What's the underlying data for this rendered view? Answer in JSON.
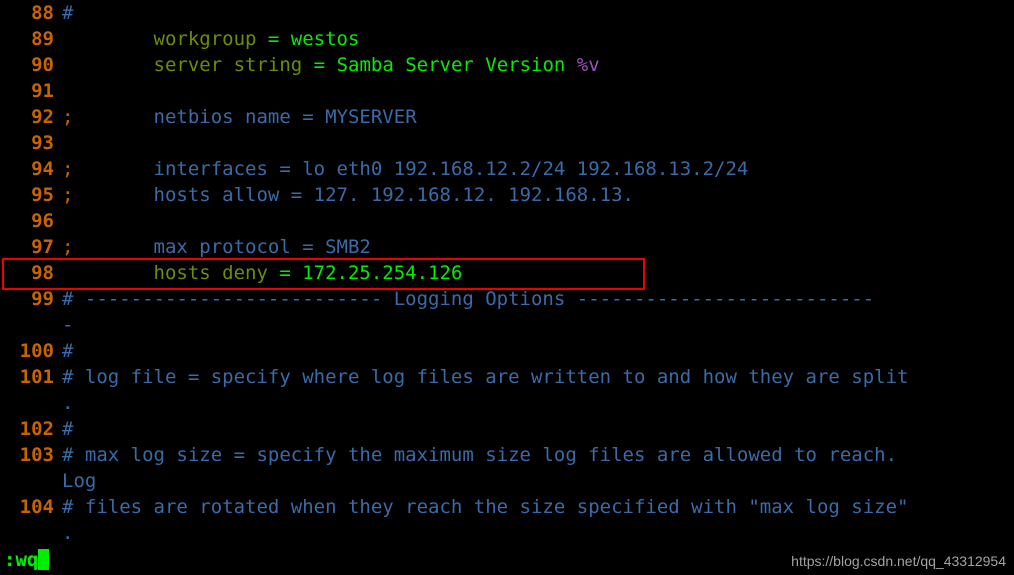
{
  "app": {
    "kind": "terminal-vim-editor",
    "background": "#000000",
    "filename_context": "smb.conf"
  },
  "colors": {
    "line_number": "#C86400",
    "comment_blue": "#3A6BA8",
    "key_olive": "#6B8E08",
    "value_green": "#00EE00",
    "special_purple": "#A050C0",
    "annotation_red": "#EE0000",
    "watermark_gray": "#BFBFBF",
    "background": "#000000"
  },
  "editor": {
    "lines": [
      {
        "number": "88",
        "segments": [
          {
            "text": "#",
            "style": "c-comment"
          }
        ]
      },
      {
        "number": "89",
        "segments": [
          {
            "text": "        ",
            "style": "c-plain"
          },
          {
            "text": "workgroup",
            "style": "c-key"
          },
          {
            "text": " = ",
            "style": "c-eq"
          },
          {
            "text": "westos",
            "style": "c-val"
          }
        ]
      },
      {
        "number": "90",
        "segments": [
          {
            "text": "        ",
            "style": "c-plain"
          },
          {
            "text": "server string",
            "style": "c-key"
          },
          {
            "text": " = ",
            "style": "c-eq"
          },
          {
            "text": "Samba Server Version ",
            "style": "c-val"
          },
          {
            "text": "%v",
            "style": "c-special"
          }
        ]
      },
      {
        "number": "91",
        "segments": []
      },
      {
        "number": "92",
        "segments": [
          {
            "text": ";",
            "style": "c-semicolon"
          },
          {
            "text": "       ",
            "style": "c-plain"
          },
          {
            "text": "netbios name = MYSERVER",
            "style": "c-comment"
          }
        ]
      },
      {
        "number": "93",
        "segments": []
      },
      {
        "number": "94",
        "segments": [
          {
            "text": ";",
            "style": "c-semicolon"
          },
          {
            "text": "       ",
            "style": "c-plain"
          },
          {
            "text": "interfaces = lo eth0 192.168.12.2/24 192.168.13.2/24",
            "style": "c-comment"
          }
        ]
      },
      {
        "number": "95",
        "segments": [
          {
            "text": ";",
            "style": "c-semicolon"
          },
          {
            "text": "       ",
            "style": "c-plain"
          },
          {
            "text": "hosts allow = 127. 192.168.12. 192.168.13.",
            "style": "c-comment"
          }
        ]
      },
      {
        "number": "96",
        "segments": []
      },
      {
        "number": "97",
        "segments": [
          {
            "text": ";",
            "style": "c-semicolon"
          },
          {
            "text": "       ",
            "style": "c-plain"
          },
          {
            "text": "max protocol = SMB2",
            "style": "c-comment"
          }
        ]
      },
      {
        "number": "98",
        "highlighted": true,
        "segments": [
          {
            "text": "        ",
            "style": "c-plain"
          },
          {
            "text": "hosts deny",
            "style": "c-key"
          },
          {
            "text": " = ",
            "style": "c-eq"
          },
          {
            "text": "172.25.254.126",
            "style": "c-val"
          }
        ]
      },
      {
        "number": "99",
        "segments": [
          {
            "text": "# -------------------------- Logging Options --------------------------",
            "style": "c-comment"
          }
        ]
      },
      {
        "number": "",
        "wrapped": true,
        "segments": [
          {
            "text": "-",
            "style": "c-comment"
          }
        ]
      },
      {
        "number": "100",
        "segments": [
          {
            "text": "#",
            "style": "c-comment"
          }
        ]
      },
      {
        "number": "101",
        "segments": [
          {
            "text": "# log file = specify where log files are written to and how they are split",
            "style": "c-comment"
          }
        ]
      },
      {
        "number": "",
        "wrapped": true,
        "segments": [
          {
            "text": ".",
            "style": "c-comment"
          }
        ]
      },
      {
        "number": "102",
        "segments": [
          {
            "text": "#",
            "style": "c-comment"
          }
        ]
      },
      {
        "number": "103",
        "segments": [
          {
            "text": "# max log size = specify the maximum size log files are allowed to reach.",
            "style": "c-comment"
          }
        ]
      },
      {
        "number": "",
        "wrapped": true,
        "segments": [
          {
            "text": "Log",
            "style": "c-comment"
          }
        ]
      },
      {
        "number": "104",
        "segments": [
          {
            "text": "# files are rotated when they reach the size specified with \"max log size\"",
            "style": "c-comment"
          }
        ]
      },
      {
        "number": "",
        "wrapped": true,
        "segments": [
          {
            "text": ".",
            "style": "c-comment"
          }
        ]
      }
    ]
  },
  "annotation": {
    "label": "hosts-deny-highlight-box",
    "target_line": "98",
    "color": "#EE0000"
  },
  "statusline": {
    "command": ":wq",
    "cursor": "block"
  },
  "watermark": {
    "text": "https://blog.csdn.net/qq_43312954"
  }
}
